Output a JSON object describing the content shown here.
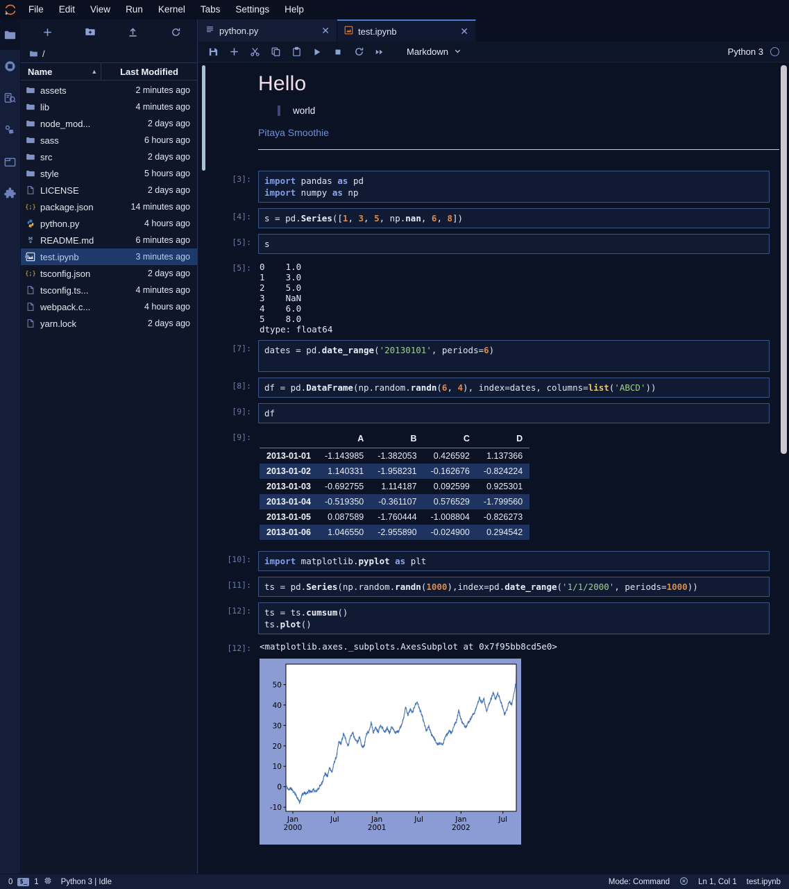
{
  "menubar": {
    "logo_icon": "jupyter-logo-icon",
    "items": [
      "File",
      "Edit",
      "View",
      "Run",
      "Kernel",
      "Tabs",
      "Settings",
      "Help"
    ]
  },
  "activitybar": {
    "items": [
      {
        "name": "file-browser-icon",
        "label": "File Browser",
        "active": true
      },
      {
        "name": "running-kernels-icon",
        "label": "Running Terminals and Kernels",
        "active": false
      },
      {
        "name": "command-palette-icon",
        "label": "Commands",
        "active": false
      },
      {
        "name": "property-inspector-icon",
        "label": "Property Inspector",
        "active": false
      },
      {
        "name": "open-tabs-icon",
        "label": "Open Tabs",
        "active": false
      },
      {
        "name": "extension-manager-icon",
        "label": "Extension Manager",
        "active": false
      }
    ]
  },
  "filebrowser": {
    "toolbar": [
      {
        "name": "new-launcher-button",
        "icon": "plus-icon"
      },
      {
        "name": "new-folder-button",
        "icon": "new-folder-icon"
      },
      {
        "name": "upload-button",
        "icon": "upload-icon"
      },
      {
        "name": "refresh-button",
        "icon": "refresh-icon"
      }
    ],
    "breadcrumb": "/",
    "columns": {
      "name": "Name",
      "modified": "Last Modified"
    },
    "sort_direction": "ascending",
    "items": [
      {
        "name": "assets",
        "type": "folder",
        "modified": "2 minutes ago",
        "selected": false
      },
      {
        "name": "lib",
        "type": "folder",
        "modified": "4 minutes ago",
        "selected": false
      },
      {
        "name": "node_mod...",
        "type": "folder",
        "modified": "2 days ago",
        "selected": false
      },
      {
        "name": "sass",
        "type": "folder",
        "modified": "6 hours ago",
        "selected": false
      },
      {
        "name": "src",
        "type": "folder",
        "modified": "2 days ago",
        "selected": false
      },
      {
        "name": "style",
        "type": "folder",
        "modified": "5 hours ago",
        "selected": false
      },
      {
        "name": "LICENSE",
        "type": "file",
        "modified": "2 days ago",
        "selected": false
      },
      {
        "name": "package.json",
        "type": "json",
        "modified": "14 minutes ago",
        "selected": false
      },
      {
        "name": "python.py",
        "type": "python",
        "modified": "4 hours ago",
        "selected": false
      },
      {
        "name": "README.md",
        "type": "markdown",
        "modified": "6 minutes ago",
        "selected": false
      },
      {
        "name": "test.ipynb",
        "type": "notebook",
        "modified": "3 minutes ago",
        "selected": true,
        "running": true
      },
      {
        "name": "tsconfig.json",
        "type": "json",
        "modified": "2 days ago",
        "selected": false
      },
      {
        "name": "tsconfig.ts...",
        "type": "file",
        "modified": "4 minutes ago",
        "selected": false
      },
      {
        "name": "webpack.c...",
        "type": "file",
        "modified": "4 hours ago",
        "selected": false
      },
      {
        "name": "yarn.lock",
        "type": "file",
        "modified": "2 days ago",
        "selected": false
      }
    ]
  },
  "tabs": [
    {
      "label": "python.py",
      "icon": "text-file-icon",
      "active": false,
      "close_icon": "close-icon"
    },
    {
      "label": "test.ipynb",
      "icon": "notebook-icon",
      "active": true,
      "close_icon": "close-icon"
    }
  ],
  "notebook_toolbar": {
    "buttons": [
      {
        "name": "save-button",
        "icon": "save-icon"
      },
      {
        "name": "insert-cell-button",
        "icon": "plus-icon"
      },
      {
        "name": "cut-cell-button",
        "icon": "scissors-icon"
      },
      {
        "name": "copy-cell-button",
        "icon": "copy-icon"
      },
      {
        "name": "paste-cell-button",
        "icon": "paste-icon"
      },
      {
        "name": "run-cell-button",
        "icon": "play-icon"
      },
      {
        "name": "interrupt-kernel-button",
        "icon": "stop-icon"
      },
      {
        "name": "restart-kernel-button",
        "icon": "restart-icon"
      },
      {
        "name": "restart-run-all-button",
        "icon": "fast-forward-icon"
      }
    ],
    "cell_type": "Markdown",
    "cell_type_caret": "chevron-down-icon",
    "kernel_name": "Python 3",
    "kernel_indicator": "idle-circle-icon"
  },
  "cells": [
    {
      "type": "markdown",
      "prompt": "",
      "selected": true,
      "heading": "Hello",
      "blockquote": "world",
      "link": "Pitaya Smoothie",
      "has_rule": true
    },
    {
      "type": "code",
      "prompt": "[3]:",
      "lines": [
        [
          {
            "t": "import",
            "c": "kw"
          },
          {
            "t": " pandas ",
            "c": ""
          },
          {
            "t": "as",
            "c": "kw2"
          },
          {
            "t": " pd",
            "c": ""
          }
        ],
        [
          {
            "t": "import",
            "c": "kw"
          },
          {
            "t": " numpy ",
            "c": ""
          },
          {
            "t": "as",
            "c": "kw2"
          },
          {
            "t": " np",
            "c": ""
          }
        ]
      ],
      "tall": true
    },
    {
      "type": "code",
      "prompt": "[4]:",
      "lines": [
        [
          {
            "t": "s = pd.",
            "c": ""
          },
          {
            "t": "Series",
            "c": "fn"
          },
          {
            "t": "([",
            "c": ""
          },
          {
            "t": "1",
            "c": "num"
          },
          {
            "t": ", ",
            "c": ""
          },
          {
            "t": "3",
            "c": "num"
          },
          {
            "t": ", ",
            "c": ""
          },
          {
            "t": "5",
            "c": "num"
          },
          {
            "t": ", np.",
            "c": ""
          },
          {
            "t": "nan",
            "c": "fn"
          },
          {
            "t": ", ",
            "c": ""
          },
          {
            "t": "6",
            "c": "num"
          },
          {
            "t": ", ",
            "c": ""
          },
          {
            "t": "8",
            "c": "num"
          },
          {
            "t": "])",
            "c": ""
          }
        ]
      ],
      "tall": false
    },
    {
      "type": "code",
      "prompt": "[5]:",
      "lines": [
        [
          {
            "t": "s",
            "c": ""
          }
        ]
      ],
      "tall": false
    },
    {
      "type": "output-text",
      "prompt": "[5]:",
      "text": "0    1.0\n1    3.0\n2    5.0\n3    NaN\n4    6.0\n5    8.0\ndtype: float64"
    },
    {
      "type": "code",
      "prompt": "[7]:",
      "lines": [
        [
          {
            "t": "dates = pd.",
            "c": ""
          },
          {
            "t": "date_range",
            "c": "fn"
          },
          {
            "t": "(",
            "c": ""
          },
          {
            "t": "'20130101'",
            "c": "str"
          },
          {
            "t": ", periods=",
            "c": ""
          },
          {
            "t": "6",
            "c": "num"
          },
          {
            "t": ")",
            "c": ""
          }
        ]
      ],
      "tall": true
    },
    {
      "type": "code",
      "prompt": "[8]:",
      "lines": [
        [
          {
            "t": "df = pd.",
            "c": ""
          },
          {
            "t": "DataFrame",
            "c": "fn"
          },
          {
            "t": "(np.random.",
            "c": ""
          },
          {
            "t": "randn",
            "c": "fn"
          },
          {
            "t": "(",
            "c": ""
          },
          {
            "t": "6",
            "c": "num"
          },
          {
            "t": ", ",
            "c": ""
          },
          {
            "t": "4",
            "c": "num"
          },
          {
            "t": "), index=dates, columns=",
            "c": ""
          },
          {
            "t": "list",
            "c": "bi"
          },
          {
            "t": "(",
            "c": ""
          },
          {
            "t": "'ABCD'",
            "c": "str"
          },
          {
            "t": "))",
            "c": ""
          }
        ]
      ],
      "tall": false
    },
    {
      "type": "code",
      "prompt": "[9]:",
      "lines": [
        [
          {
            "t": "df",
            "c": ""
          }
        ]
      ],
      "tall": false
    },
    {
      "type": "output-table",
      "prompt": "[9]:"
    },
    {
      "type": "code",
      "prompt": "[10]:",
      "lines": [
        [
          {
            "t": "import",
            "c": "kw"
          },
          {
            "t": " matplotlib.",
            "c": ""
          },
          {
            "t": "pyplot",
            "c": "fn"
          },
          {
            "t": " ",
            "c": ""
          },
          {
            "t": "as",
            "c": "kw2"
          },
          {
            "t": " plt",
            "c": ""
          }
        ]
      ],
      "tall": false
    },
    {
      "type": "code",
      "prompt": "[11]:",
      "lines": [
        [
          {
            "t": "ts = pd.",
            "c": ""
          },
          {
            "t": "Series",
            "c": "fn"
          },
          {
            "t": "(np.random.",
            "c": ""
          },
          {
            "t": "randn",
            "c": "fn"
          },
          {
            "t": "(",
            "c": ""
          },
          {
            "t": "1000",
            "c": "num"
          },
          {
            "t": "),index=pd.",
            "c": ""
          },
          {
            "t": "date_range",
            "c": "fn"
          },
          {
            "t": "(",
            "c": ""
          },
          {
            "t": "'1/1/2000'",
            "c": "str"
          },
          {
            "t": ", periods=",
            "c": ""
          },
          {
            "t": "1000",
            "c": "num"
          },
          {
            "t": "))",
            "c": ""
          }
        ]
      ],
      "tall": false
    },
    {
      "type": "code",
      "prompt": "[12]:",
      "lines": [
        [
          {
            "t": "ts = ts.",
            "c": ""
          },
          {
            "t": "cumsum",
            "c": "fn"
          },
          {
            "t": "()",
            "c": ""
          }
        ],
        [
          {
            "t": "ts.",
            "c": ""
          },
          {
            "t": "plot",
            "c": "fn"
          },
          {
            "t": "()",
            "c": ""
          }
        ]
      ],
      "tall": true
    },
    {
      "type": "output-plain",
      "prompt": "[12]:",
      "text": "<matplotlib.axes._subplots.AxesSubplot at 0x7f95bb8cd5e0>"
    },
    {
      "type": "output-figure",
      "prompt": ""
    }
  ],
  "dataframe": {
    "columns": [
      "A",
      "B",
      "C",
      "D"
    ],
    "index": [
      "2013-01-01",
      "2013-01-02",
      "2013-01-03",
      "2013-01-04",
      "2013-01-05",
      "2013-01-06"
    ],
    "rows": [
      [
        "-1.143985",
        "-1.382053",
        "0.426592",
        "1.137366"
      ],
      [
        "1.140331",
        "-1.958231",
        "-0.162676",
        "-0.824224"
      ],
      [
        "-0.692755",
        "1.114187",
        "0.092599",
        "0.925301"
      ],
      [
        "-0.519350",
        "-0.361107",
        "0.576529",
        "-1.799560"
      ],
      [
        "0.087589",
        "-1.760444",
        "-1.008804",
        "-0.826273"
      ],
      [
        "1.046550",
        "-2.955890",
        "-0.024900",
        "0.294542"
      ]
    ]
  },
  "chart_data": {
    "type": "line",
    "title": "",
    "xlabel": "",
    "ylabel": "",
    "ytick_labels": [
      "-10",
      "0",
      "10",
      "20",
      "30",
      "40",
      "50"
    ],
    "ytick_values": [
      -10,
      0,
      10,
      20,
      30,
      40,
      50
    ],
    "ylim": [
      -12,
      60
    ],
    "xtick_labels": [
      "Jan\n2000",
      "Jul",
      "Jan\n2001",
      "Jul",
      "Jan\n2002",
      "Jul"
    ],
    "xtick_major": [
      "Jan",
      "Jul",
      "Jan",
      "Jul",
      "Jan",
      "Jul"
    ],
    "xtick_minor": [
      "2000",
      "",
      "2001",
      "",
      "2002",
      ""
    ],
    "xlim": [
      0,
      1000
    ],
    "grid": false,
    "legend": "none",
    "line_color": "#4473b3",
    "series": [
      {
        "name": "ts",
        "x": [
          0,
          10,
          20,
          30,
          40,
          50,
          60,
          70,
          80,
          90,
          100,
          110,
          120,
          130,
          140,
          150,
          160,
          170,
          180,
          190,
          200,
          210,
          220,
          230,
          240,
          250,
          260,
          270,
          280,
          290,
          300,
          310,
          320,
          330,
          340,
          350,
          360,
          370,
          380,
          390,
          400,
          410,
          420,
          430,
          440,
          450,
          460,
          470,
          480,
          490,
          500,
          510,
          520,
          530,
          540,
          550,
          560,
          570,
          580,
          590,
          600,
          610,
          620,
          630,
          640,
          650,
          660,
          670,
          680,
          690,
          700,
          710,
          720,
          730,
          740,
          750,
          760,
          770,
          780,
          790,
          800,
          810,
          820,
          830,
          840,
          850,
          860,
          870,
          880,
          890,
          900,
          910,
          920,
          930,
          940,
          950,
          960,
          970,
          980,
          990,
          999
        ],
        "values": [
          0.5,
          -1.5,
          -0.8,
          -2.0,
          -3.5,
          -5.5,
          -7.5,
          -4.0,
          -3.0,
          -3.5,
          -2.0,
          -2.5,
          -1.5,
          -2.5,
          -1.0,
          0.5,
          3.0,
          6.5,
          5.0,
          9.5,
          7.0,
          12.0,
          15.0,
          22.0,
          21.0,
          26.0,
          23.0,
          20.0,
          24.5,
          26.5,
          23.0,
          22.0,
          24.0,
          19.5,
          20.0,
          26.0,
          27.0,
          31.5,
          26.5,
          29.5,
          26.5,
          30.0,
          28.5,
          26.5,
          28.5,
          26.5,
          29.5,
          27.0,
          26.5,
          27.5,
          30.0,
          33.0,
          39.0,
          35.0,
          38.0,
          36.0,
          40.0,
          41.5,
          38.0,
          35.0,
          31.0,
          27.0,
          29.5,
          26.0,
          24.5,
          22.0,
          20.5,
          21.5,
          20.5,
          23.5,
          26.0,
          27.5,
          26.5,
          30.0,
          32.0,
          37.5,
          33.0,
          30.5,
          29.5,
          31.0,
          33.0,
          35.0,
          36.5,
          40.0,
          43.5,
          41.0,
          43.0,
          37.0,
          40.0,
          43.0,
          45.5,
          43.0,
          45.5,
          42.5,
          39.0,
          35.5,
          38.0,
          42.0,
          40.0,
          45.5,
          51.5,
          56.5
        ]
      }
    ]
  },
  "statusbar": {
    "terminals_count": "0",
    "terminal_icon": "terminal-icon",
    "kernels_count": "1",
    "kernel_icon": "cpu-icon",
    "kernel_status": "Python 3 | Idle",
    "mode": "Mode: Command",
    "save_icon": "unsaved-changes-icon",
    "cursor": "Ln 1, Col 1",
    "filename": "test.ipynb"
  }
}
